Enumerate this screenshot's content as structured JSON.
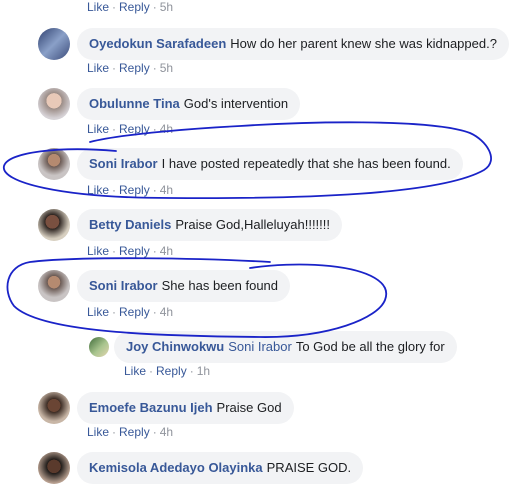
{
  "actions": {
    "like": "Like",
    "reply": "Reply",
    "sep": "·"
  },
  "top_actions": {
    "time": "5h"
  },
  "comments": [
    {
      "author": "Oyedokun Sarafadeen",
      "text": "How do her parent knew she was kidnapped.?",
      "time": "5h"
    },
    {
      "author": "Obulunne Tina",
      "text": "God's intervention",
      "time": "4h"
    },
    {
      "author": "Soni Irabor",
      "text": "I have posted repeatedly that she has been found.",
      "time": "4h"
    },
    {
      "author": "Betty Daniels",
      "text": "Praise God,Halleluyah!!!!!!!",
      "time": "4h"
    },
    {
      "author": "Soni Irabor",
      "text": "She has been found",
      "time": "4h"
    },
    {
      "author": "Joy Chinwokwu",
      "mention": "Soni Irabor",
      "text": "To God be all the glory for",
      "time": "1h"
    },
    {
      "author": "Emoefe Bazunu Ijeh",
      "text": "Praise God",
      "time": "4h"
    },
    {
      "author": "Kemisola Adedayo Olayinka",
      "text": "PRAISE GOD.",
      "time": ""
    }
  ],
  "colors": {
    "link": "#385898",
    "bubble": "#f2f3f5",
    "meta": "#90949c",
    "annotation": "#1a23c8"
  }
}
